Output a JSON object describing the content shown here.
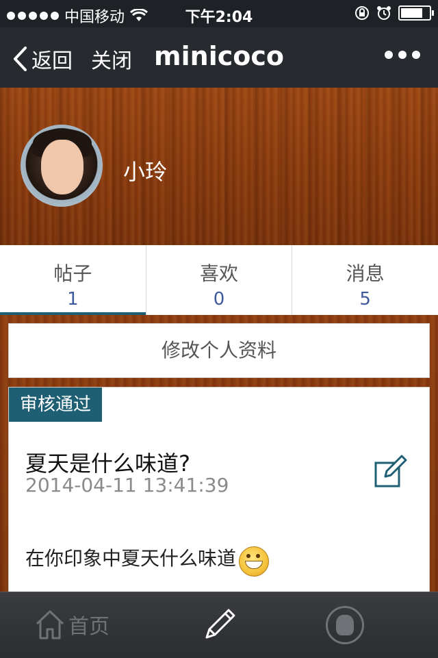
{
  "status_bar": {
    "carrier": "中国移动",
    "time": "下午2:04"
  },
  "nav": {
    "back_label": "返回",
    "close_label": "关闭",
    "title": "minicoco"
  },
  "profile": {
    "username": "小玲"
  },
  "tabs": [
    {
      "label": "帖子",
      "count": "1"
    },
    {
      "label": "喜欢",
      "count": "0"
    },
    {
      "label": "消息",
      "count": "5"
    }
  ],
  "edit_profile_label": "修改个人资料",
  "post": {
    "status": "审核通过",
    "title": "夏天是什么味道?",
    "time": "2014-04-11 13:41:39",
    "body": "在你印象中夏天什么味道"
  },
  "toolbar": {
    "home_label": "首页"
  },
  "colors": {
    "nav_bg": "#272b30",
    "accent": "#1f5f73",
    "count_blue": "#3f5a9a"
  }
}
